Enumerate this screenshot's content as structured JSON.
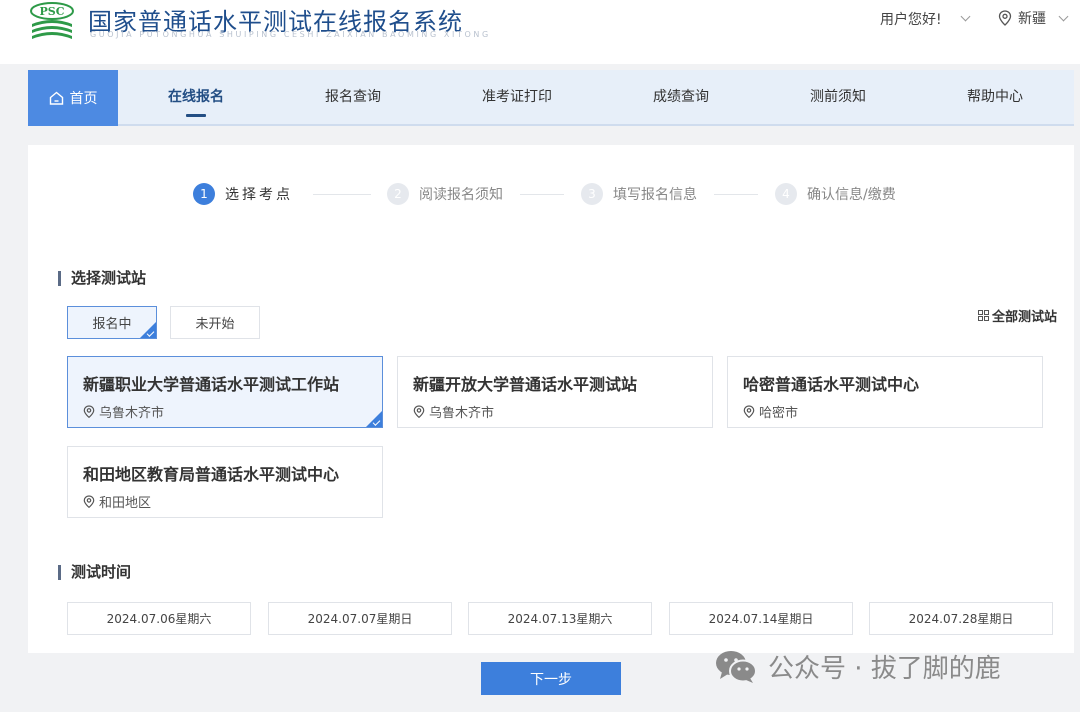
{
  "header": {
    "logo_text": "PSC",
    "title": "国家普通话水平测试在线报名系统",
    "subtitle": "GUOJIA PUTONGHUA SHUIPING CESHI ZAIXIAN BAOMING XITONG",
    "user_greeting": "用户您好!",
    "region": "新疆"
  },
  "nav": {
    "home": "首页",
    "items": [
      "在线报名",
      "报名查询",
      "准考证打印",
      "成绩查询",
      "测前须知",
      "帮助中心"
    ],
    "active_index": 0
  },
  "steps": [
    {
      "num": "1",
      "label": "选择考点"
    },
    {
      "num": "2",
      "label": "阅读报名须知"
    },
    {
      "num": "3",
      "label": "填写报名信息"
    },
    {
      "num": "4",
      "label": "确认信息/缴费"
    }
  ],
  "station_section": {
    "title": "选择测试站",
    "filters": [
      "报名中",
      "未开始"
    ],
    "all_link": "全部测试站",
    "stations": [
      {
        "name": "新疆职业大学普通话水平测试工作站",
        "city": "乌鲁木齐市"
      },
      {
        "name": "新疆开放大学普通话水平测试站",
        "city": "乌鲁木齐市"
      },
      {
        "name": "哈密普通话水平测试中心",
        "city": "哈密市"
      },
      {
        "name": "和田地区教育局普通话水平测试中心",
        "city": "和田地区"
      }
    ]
  },
  "time_section": {
    "title": "测试时间",
    "dates": [
      "2024.07.06星期六",
      "2024.07.07星期日",
      "2024.07.13星期六",
      "2024.07.14星期日",
      "2024.07.28星期日"
    ]
  },
  "next_button": "下一步",
  "watermark": "公众号 · 拔了脚的鹿",
  "colors": {
    "primary": "#3d7fdc",
    "nav_bg": "#e7eff9",
    "title": "#1f4e8c",
    "logo_green": "#2e9a48"
  }
}
